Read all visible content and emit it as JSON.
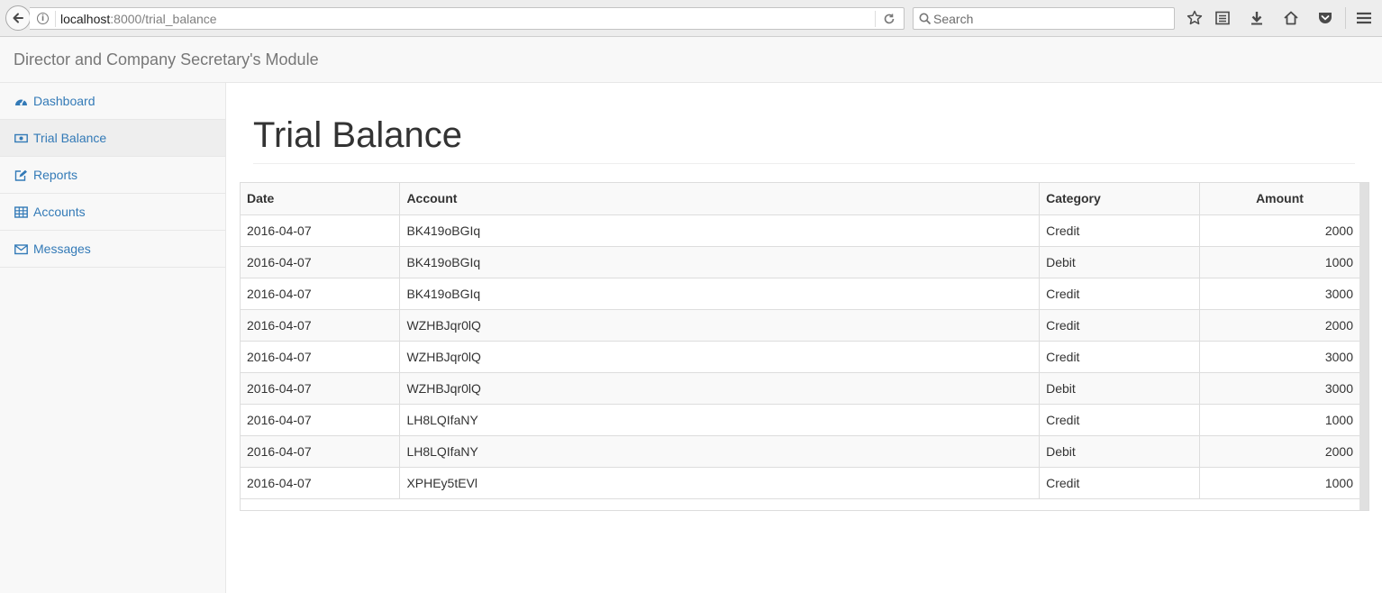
{
  "browser": {
    "url_host": "localhost",
    "url_path": ":8000/trial_balance",
    "search_placeholder": "Search"
  },
  "navbar": {
    "brand": "Director and Company Secretary's Module"
  },
  "sidebar": {
    "items": [
      {
        "label": "Dashboard",
        "icon": "dashboard-icon"
      },
      {
        "label": "Trial Balance",
        "icon": "money-icon",
        "active": true
      },
      {
        "label": "Reports",
        "icon": "edit-icon"
      },
      {
        "label": "Accounts",
        "icon": "table-icon"
      },
      {
        "label": "Messages",
        "icon": "envelope-icon"
      }
    ]
  },
  "page": {
    "title": "Trial Balance"
  },
  "table": {
    "headers": [
      "Date",
      "Account",
      "Category",
      "Amount"
    ],
    "rows": [
      [
        "2016-04-07",
        "BK419oBGIq",
        "Credit",
        "2000"
      ],
      [
        "2016-04-07",
        "BK419oBGIq",
        "Debit",
        "1000"
      ],
      [
        "2016-04-07",
        "BK419oBGIq",
        "Credit",
        "3000"
      ],
      [
        "2016-04-07",
        "WZHBJqr0lQ",
        "Credit",
        "2000"
      ],
      [
        "2016-04-07",
        "WZHBJqr0lQ",
        "Credit",
        "3000"
      ],
      [
        "2016-04-07",
        "WZHBJqr0lQ",
        "Debit",
        "3000"
      ],
      [
        "2016-04-07",
        "LH8LQIfaNY",
        "Credit",
        "1000"
      ],
      [
        "2016-04-07",
        "LH8LQIfaNY",
        "Debit",
        "2000"
      ],
      [
        "2016-04-07",
        "XPHEy5tEVl",
        "Credit",
        "1000"
      ]
    ]
  },
  "colors": {
    "link": "#337ab7",
    "sidebar_bg": "#f8f8f8",
    "active_bg": "#eeeeee"
  }
}
